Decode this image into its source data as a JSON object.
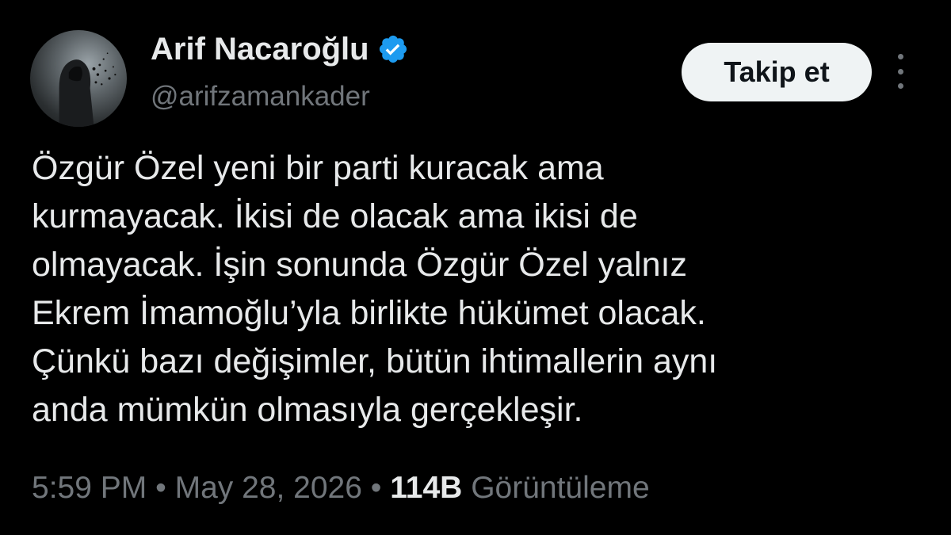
{
  "author": {
    "display_name": "Arif Nacaroğlu",
    "handle": "@arifzamankader",
    "verified": true,
    "avatar_icon": "hooded-figure-dispersing-avatar"
  },
  "follow_button": {
    "label": "Takip et"
  },
  "more_menu": {
    "icon": "vertical-ellipsis-icon"
  },
  "tweet": {
    "lines": [
      "Özgür Özel yeni bir parti kuracak ama",
      "kurmayacak. İkisi de olacak ama ikisi de",
      "olmayacak. İşin sonunda Özgür Özel yalnız",
      "Ekrem İmamoğlu’yla birlikte hükümet olacak.",
      "Çünkü bazı değişimler, bütün ihtimallerin aynı",
      "anda mümkün olmasıyla gerçekleşir."
    ]
  },
  "meta": {
    "time": "5:59 PM",
    "separator": "•",
    "date": "May 28, 2026",
    "views_count": "114B",
    "views_label": "Görüntüleme"
  },
  "colors": {
    "background": "#000000",
    "text_primary": "#e7e9ea",
    "text_secondary": "#71767b",
    "verified_badge": "#1d9bf0",
    "follow_button_bg": "#eff3f4",
    "follow_button_text": "#0f1419"
  }
}
